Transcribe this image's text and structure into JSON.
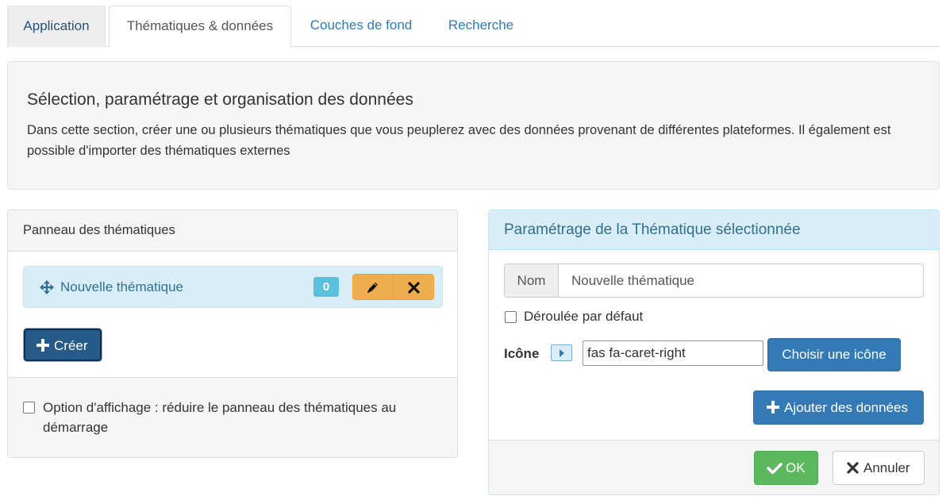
{
  "tabs": [
    {
      "label": "Application"
    },
    {
      "label": "Thématiques & données"
    },
    {
      "label": "Couches de fond"
    },
    {
      "label": "Recherche"
    }
  ],
  "intro": {
    "title": "Sélection, paramétrage et organisation des données",
    "text": "Dans cette section, créer une ou plusieurs thématiques que vous peuplerez avec des données provenant de différentes plateformes. Il également est possible d'importer des thématiques externes"
  },
  "left_panel": {
    "title": "Panneau des thématiques",
    "theme_item": {
      "label": "Nouvelle thématique",
      "count": "0"
    },
    "create_button": "Créer",
    "option_label": "Option d'affichage : réduire le panneau des thématiques au démarrage"
  },
  "right_panel": {
    "title": "Paramétrage de la Thématique sélectionnée",
    "name_addon": "Nom",
    "name_value": "Nouvelle thématique",
    "collapsed_label": "Déroulée par défaut",
    "icon_label": "Icône",
    "icon_value": "fas fa-caret-right",
    "choose_icon_button": "Choisir une icône",
    "add_data_button": "Ajouter des données",
    "ok_button": "OK",
    "cancel_button": "Annuler"
  },
  "colors": {
    "primary": "#337ab7",
    "warning": "#f0ad4e",
    "success": "#5cb85c",
    "info_bg": "#d9edf7",
    "info_text": "#31708f"
  }
}
